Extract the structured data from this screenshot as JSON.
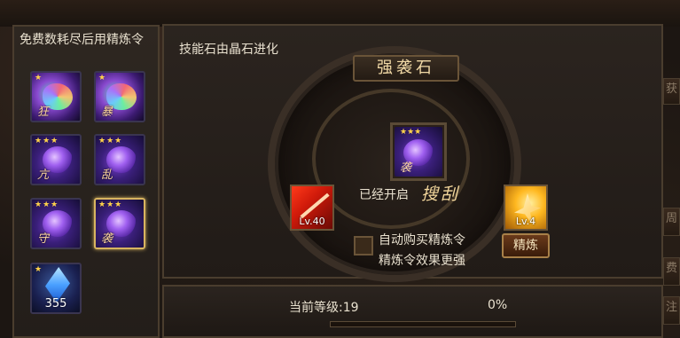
{
  "left_panel": {
    "title": "免费数耗尽后用精炼令",
    "gems": [
      {
        "stars": "★",
        "glyph": "狂",
        "kind": "rainbow"
      },
      {
        "stars": "★",
        "glyph": "暴",
        "kind": "rainbow"
      },
      {
        "stars": "★★★",
        "glyph": "亢",
        "kind": "purple"
      },
      {
        "stars": "★★★",
        "glyph": "乱",
        "kind": "purple"
      },
      {
        "stars": "★★★",
        "glyph": "守",
        "kind": "purple"
      },
      {
        "stars": "★★★",
        "glyph": "袭",
        "kind": "purple",
        "selected": true
      },
      {
        "stars": "★",
        "count": "355",
        "kind": "crystal"
      }
    ]
  },
  "main": {
    "description": "技能石由晶石进化",
    "stone_name": "强袭石",
    "center_gem": {
      "stars": "★★★",
      "glyph": "袭"
    },
    "left_skill": {
      "level": "Lv.40"
    },
    "right_skill": {
      "level": "Lv.4"
    },
    "opened_label": "已经开启",
    "opened_skill": "搜刮",
    "auto_buy_label": "自动购买精炼令",
    "effect_note": "精炼令效果更强",
    "refine_button": "精炼"
  },
  "bottom": {
    "level_text": "当前等级:19",
    "progress_text": "0%",
    "progress_value": 0
  },
  "side_tabs": [
    "获",
    "周",
    "费",
    "注"
  ],
  "colors": {
    "accent_gold": "#d8b460",
    "text": "#e9e1cf",
    "panel_bg": "#2b241f"
  }
}
